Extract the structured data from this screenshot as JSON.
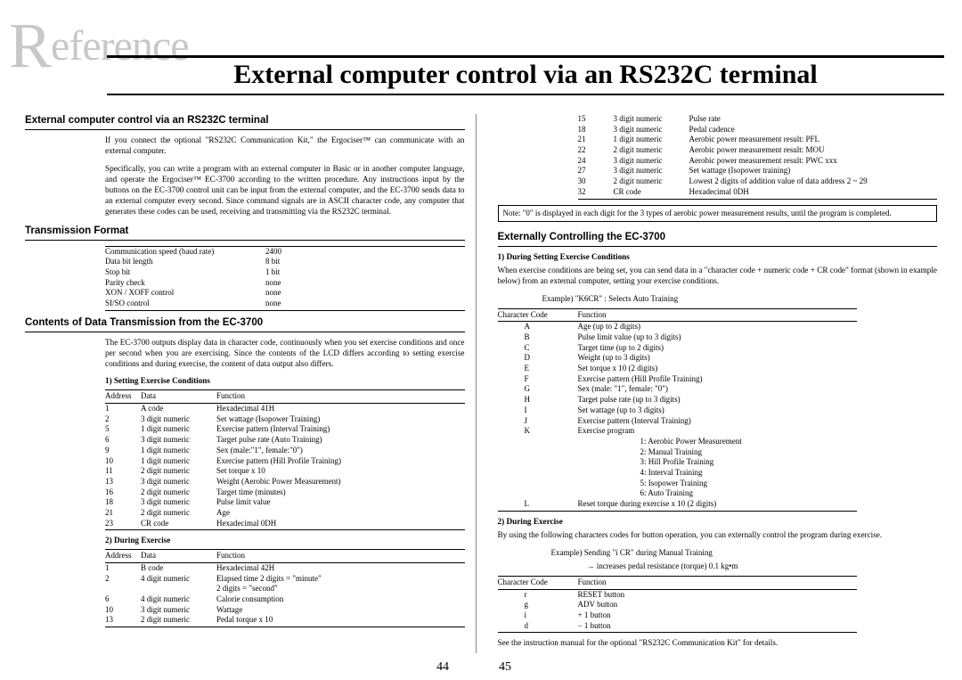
{
  "watermark": "eference",
  "watermark_r": "R",
  "title": "External computer control via an RS232C terminal",
  "page_left": "44",
  "page_right": "45",
  "left": {
    "h1": "External computer control via an RS232C terminal",
    "p1": "If you connect the optional \"RS232C Communication Kit,\" the Ergociser™ can communicate with an external computer.",
    "p2": "Specifically, you can write a program with an external computer in Basic or in another computer language, and operate the Ergociser™ EC-3700 according to the written procedure. Any instructions input by the buttons on the EC-3700 control unit can be input from the external computer, and the EC-3700 sends data to an external computer every second. Since command signals are in ASCII character code, any computer that generates these codes can be used, receiving and transmitting via the RS232C terminal.",
    "h2": "Transmission Format",
    "tf": [
      [
        "Communication speed (baud rate)",
        "2400"
      ],
      [
        "Data bit length",
        "8 bit"
      ],
      [
        "Stop bit",
        "1 bit"
      ],
      [
        "Parity check",
        "none"
      ],
      [
        "XON / XOFF control",
        "none"
      ],
      [
        "SI/SO control",
        "none"
      ]
    ],
    "h3": "Contents of Data Transmission from the EC-3700",
    "p3": "The EC-3700 outputs display data in character code, continuously when you set exercise conditions and once per second when you are exercising. Since the contents of the LCD differs according to setting exercise conditions and during exercise, the content of data output also differs.",
    "sub1": "1) Setting Exercise Conditions",
    "t1_head": [
      "Address",
      "Data",
      "Function"
    ],
    "t1": [
      [
        "1",
        "A code",
        "Hexadecimal 41H"
      ],
      [
        "2",
        "3 digit numeric",
        "Set wattage (Isopower Training)"
      ],
      [
        "5",
        "1 digit numeric",
        "Exercise pattern (Interval Training)"
      ],
      [
        "6",
        "3 digit numeric",
        "Target pulse rate (Auto Training)"
      ],
      [
        "9",
        "1 digit numeric",
        "Sex (male:\"1\", female:\"0\")"
      ],
      [
        "10",
        "1 digit numeric",
        "Exercise pattern (Hill Profile Training)"
      ],
      [
        "11",
        "2 digit numeric",
        "Set torque x 10"
      ],
      [
        "13",
        "3 digit numeric",
        "Weight (Aerobic Power Measurement)"
      ],
      [
        "16",
        "2 digit numeric",
        "Target time (minutes)"
      ],
      [
        "18",
        "3 digit numeric",
        "Pulse limit value"
      ],
      [
        "21",
        "2 digit numeric",
        "Age"
      ],
      [
        "23",
        "CR code",
        "Hexadecimal 0DH"
      ]
    ],
    "sub2": "2) During Exercise",
    "t2_head": [
      "Address",
      "Data",
      "Function"
    ],
    "t2": [
      [
        "1",
        "B code",
        "Hexadecimal 42H"
      ],
      [
        "2",
        "4 digit numeric",
        "Elapsed time     2 digits = \"minute\""
      ],
      [
        "",
        "",
        "                          2 digits = \"second\""
      ],
      [
        "6",
        "4 digit numeric",
        "Calorie consumption"
      ],
      [
        "10",
        "3 digit numeric",
        "Wattage"
      ],
      [
        "13",
        "2 digit numeric",
        "Pedal torque x 10"
      ]
    ]
  },
  "right": {
    "t_cont": [
      [
        "15",
        "3 digit numeric",
        "Pulse rate"
      ],
      [
        "18",
        "3 digit numeric",
        "Pedal cadence"
      ],
      [
        "21",
        "1 digit numeric",
        "Aerobic power measurement result: PFL"
      ],
      [
        "22",
        "2 digit numeric",
        "Aerobic power measurement result: MOU"
      ],
      [
        "24",
        "3 digit numeric",
        "Aerobic power measurement result: PWC xxx"
      ],
      [
        "27",
        "3 digit numeric",
        "Set wattage (Isopower training)"
      ],
      [
        "30",
        "2 digit numeric",
        "Lowest 2 digits of addition value of data address 2 ~ 29"
      ],
      [
        "32",
        "CR code",
        "Hexadecimal 0DH"
      ]
    ],
    "note": "Note: \"0\" is displayed in each digit for the 3 types of aerobic power measurement results, until the program is completed.",
    "h1": "Externally Controlling the EC-3700",
    "sub1": "1) During Setting Exercise Conditions",
    "p1": "When exercise conditions are being set, you can send data in a \"character code + numeric code + CR code\" format (shown in example below) from an external computer, setting your exercise conditions.",
    "ex1": "Example)    \"K6CR\" : Selects Auto Training",
    "cc_head": [
      "Character Code",
      "Function"
    ],
    "cc": [
      [
        "A",
        "Age (up to 2 digits)"
      ],
      [
        "B",
        "Pulse limit value (up to 3 digits)"
      ],
      [
        "C",
        "Target time (up to 2 digits)"
      ],
      [
        "D",
        "Weight (up to 3 digits)"
      ],
      [
        "E",
        "Set torque x 10 (2 digits)"
      ],
      [
        "F",
        "Exercise pattern (Hill Profile Training)"
      ],
      [
        "G",
        "Sex  (male: \"1\", female: \"0\")"
      ],
      [
        "H",
        "Target pulse rate (up to 3 digits)"
      ],
      [
        "I",
        "Set wattage (up to 3 digits)"
      ],
      [
        "J",
        "Exercise pattern (Interval Training)"
      ],
      [
        "K",
        "Exercise program"
      ]
    ],
    "prog": [
      "1: Aerobic Power Measurement",
      "2: Manual Training",
      "3: Hill Profile Training",
      "4: Interval Training",
      "5: Isopower Training",
      "6: Auto Training"
    ],
    "cc_L": [
      "L",
      "Reset torque during exercise x 10 (2 digits)"
    ],
    "sub2": "2) During Exercise",
    "p2": "By using the following characters codes for button operation, you can externally control the program during exercise.",
    "ex2a": "Example) Sending \"i CR\" during Manual Training",
    "ex2b": "→ increases pedal resistance (torque) 0.1 kg•m",
    "bc_head": [
      "Character Code",
      "Function"
    ],
    "bc": [
      [
        "r",
        "RESET button"
      ],
      [
        "g",
        "ADV button"
      ],
      [
        "i",
        "+ 1 button"
      ],
      [
        "d",
        "− 1 button"
      ]
    ],
    "p3": "See the instruction manual for the optional \"RS232C Communication Kit\" for details."
  }
}
